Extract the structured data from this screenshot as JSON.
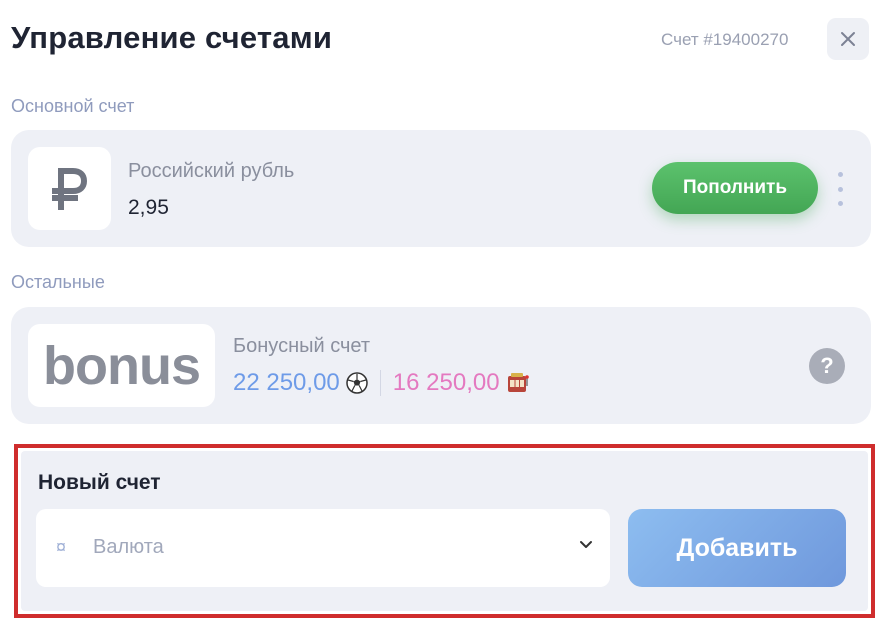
{
  "header": {
    "title": "Управление счетами",
    "account_id": "Счет #19400270",
    "close_icon": "close-icon"
  },
  "main_section": {
    "label": "Основной счет",
    "account": {
      "currency_symbol": "₽",
      "name": "Российский рубль",
      "balance": "2,95",
      "topup_label": "Пополнить"
    }
  },
  "other_section": {
    "label": "Остальные",
    "bonus": {
      "logo": "bonus",
      "name": "Бонусный счет",
      "sport_balance": "22 250,00",
      "sport_icon": "soccer-ball-icon",
      "casino_balance": "16 250,00",
      "casino_icon": "slot-machine-icon",
      "help_label": "?"
    }
  },
  "new_account": {
    "title": "Новый счет",
    "currency_symbol": "¤",
    "currency_placeholder": "Валюта",
    "add_label": "Добавить"
  },
  "colors": {
    "topup_green": "#4caf5e",
    "sport_blue": "#6e9be8",
    "casino_pink": "#e479c0",
    "highlight_red": "#cf2d2d",
    "add_blue": "#7fa9e6"
  }
}
